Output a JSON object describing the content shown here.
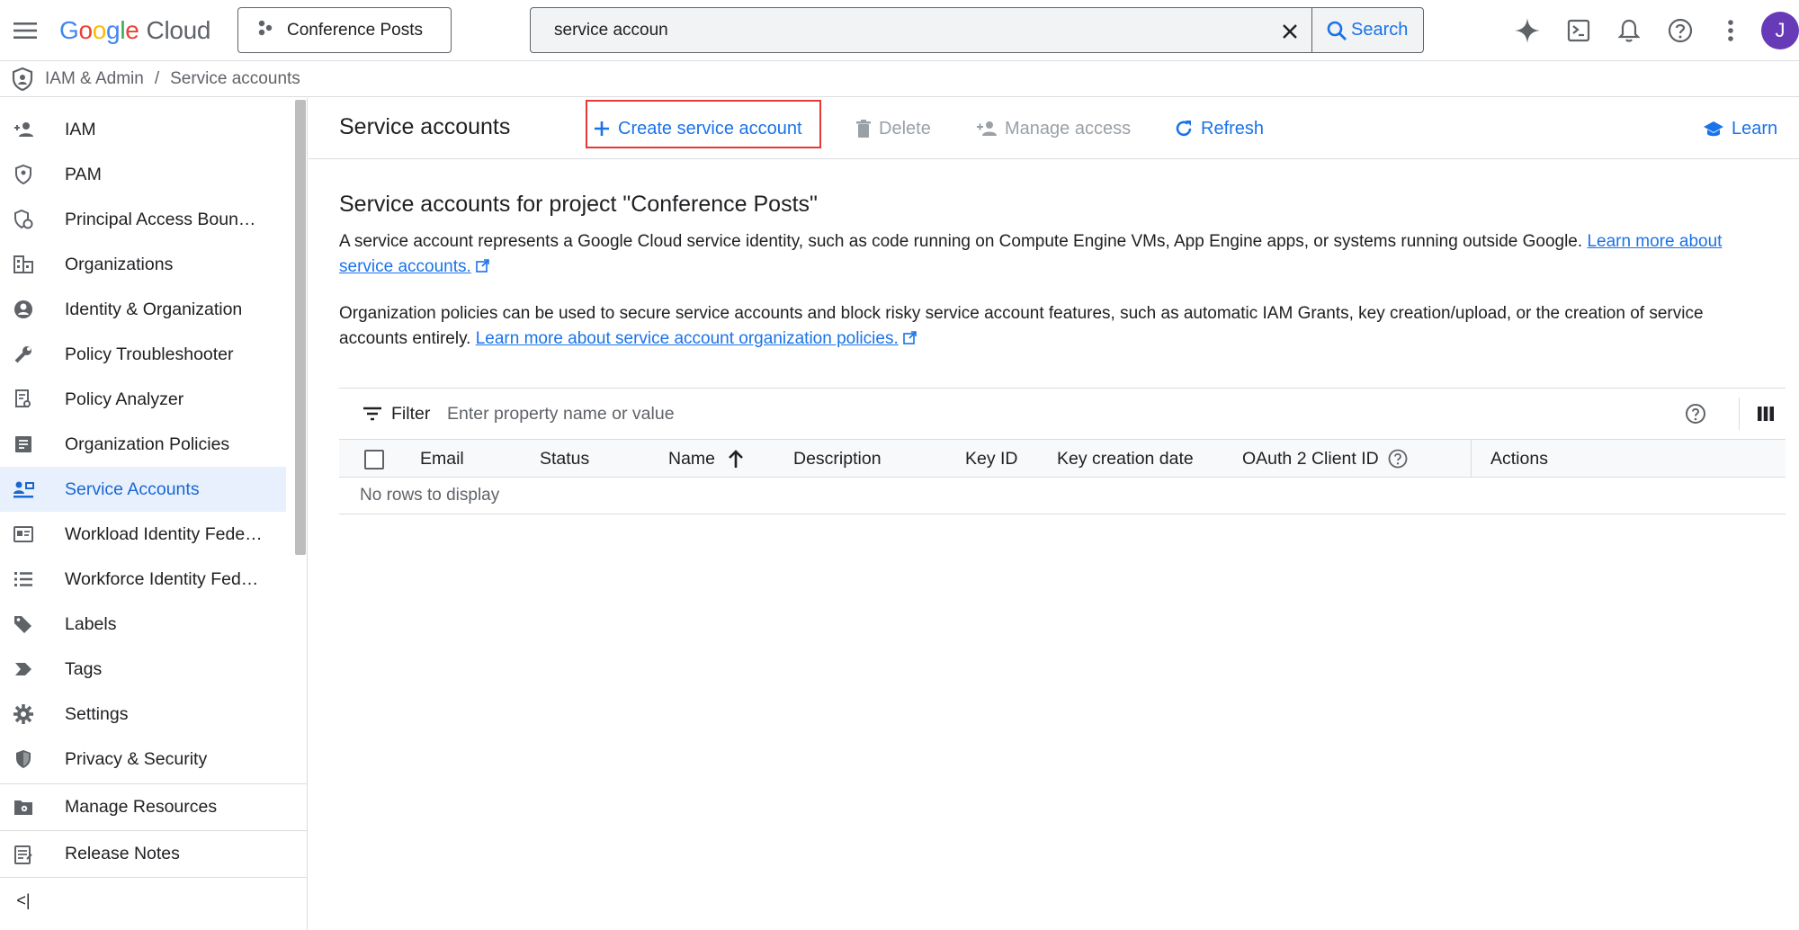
{
  "topbar": {
    "logo": {
      "g": "G",
      "o1": "o",
      "o2": "o",
      "g2": "g",
      "l": "l",
      "e": "e",
      "cloud": "Cloud"
    },
    "project_name": "Conference Posts",
    "search_value": "service accoun",
    "search_button": "Search",
    "avatar_initial": "J"
  },
  "breadcrumb": {
    "items": [
      "IAM & Admin",
      "Service accounts"
    ],
    "separator": "/"
  },
  "sidebar": {
    "items": [
      {
        "label": "IAM",
        "icon": "person-add-icon"
      },
      {
        "label": "PAM",
        "icon": "shield-person-icon"
      },
      {
        "label": "Principal Access Boun…",
        "icon": "shield-refresh-icon"
      },
      {
        "label": "Organizations",
        "icon": "building-icon"
      },
      {
        "label": "Identity & Organization",
        "icon": "account-circle-icon"
      },
      {
        "label": "Policy Troubleshooter",
        "icon": "wrench-icon"
      },
      {
        "label": "Policy Analyzer",
        "icon": "document-search-icon"
      },
      {
        "label": "Organization Policies",
        "icon": "list-doc-icon"
      },
      {
        "label": "Service Accounts",
        "icon": "service-account-icon",
        "active": true
      },
      {
        "label": "Workload Identity Fede…",
        "icon": "id-card-icon"
      },
      {
        "label": "Workforce Identity Fed…",
        "icon": "list-icon"
      },
      {
        "label": "Labels",
        "icon": "tag-icon"
      },
      {
        "label": "Tags",
        "icon": "label-arrow-icon"
      },
      {
        "label": "Settings",
        "icon": "gear-icon"
      },
      {
        "label": "Privacy & Security",
        "icon": "shield-icon"
      }
    ],
    "manage_resources": "Manage Resources",
    "release_notes": "Release Notes",
    "collapse": "<|"
  },
  "actionbar": {
    "title": "Service accounts",
    "create": "Create service account",
    "delete": "Delete",
    "manage_access": "Manage access",
    "refresh": "Refresh",
    "learn": "Learn"
  },
  "content": {
    "heading": "Service accounts for project \"Conference Posts\"",
    "para1_text": "A service account represents a Google Cloud service identity, such as code running on Compute Engine VMs, App Engine apps, or systems running outside Google. ",
    "para1_link": "Learn more about service accounts.",
    "para2_text": "Organization policies can be used to secure service accounts and block risky service account features, such as automatic IAM Grants, key creation/upload, or the creation of service accounts entirely. ",
    "para2_link": "Learn more about service account organization policies."
  },
  "table": {
    "filter_label": "Filter",
    "filter_placeholder": "Enter property name or value",
    "columns": [
      "Email",
      "Status",
      "Name",
      "Description",
      "Key ID",
      "Key creation date",
      "OAuth 2 Client ID",
      "Actions"
    ],
    "sorted_column": "Name",
    "sort_direction": "ascending",
    "empty_message": "No rows to display"
  },
  "colors": {
    "accent": "#1a73e8",
    "active_bg": "#e8f0fe",
    "highlight_border": "#e53935",
    "avatar": "#673ab7"
  }
}
